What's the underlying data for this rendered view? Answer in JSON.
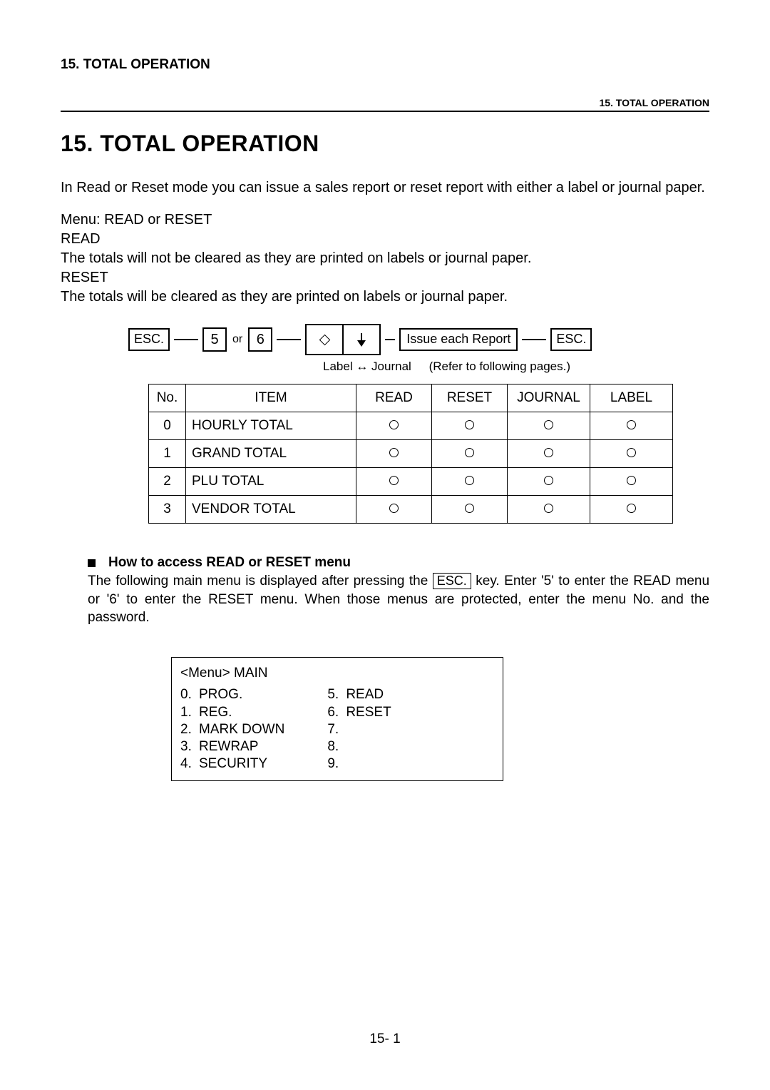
{
  "header_top": "15.  TOTAL OPERATION",
  "header_right": "15. TOTAL OPERATION",
  "title": "15.  TOTAL OPERATION",
  "intro": "In Read or Reset mode you can issue a sales report or reset report with either a label or journal paper.",
  "menu_line": "Menu:  READ or RESET",
  "read_head": "READ",
  "read_body": "The totals will not be cleared as they are printed on labels or journal paper.",
  "reset_head": "RESET",
  "reset_body": "The totals will be cleared as they are printed on labels or journal paper.",
  "diagram": {
    "esc": "ESC.",
    "k5": "5",
    "or": "or",
    "k6": "6",
    "issue": "Issue each Report",
    "label_journal": "Label ↔ Journal",
    "refer": "(Refer to following pages.)"
  },
  "table": {
    "headers": [
      "No.",
      "ITEM",
      "READ",
      "RESET",
      "JOURNAL",
      "LABEL"
    ],
    "rows": [
      {
        "no": "0",
        "item": "HOURLY TOTAL"
      },
      {
        "no": "1",
        "item": "GRAND TOTAL"
      },
      {
        "no": "2",
        "item": "PLU TOTAL"
      },
      {
        "no": "3",
        "item": "VENDOR TOTAL"
      }
    ]
  },
  "howto": {
    "title": "How to access READ or RESET menu",
    "pre": "The following main menu is displayed after pressing the",
    "esc": "ESC.",
    "post": " key.    Enter '5' to enter the READ menu or '6' to enter the RESET menu.    When those menus are protected, enter the menu No. and the password."
  },
  "menu_box": {
    "head": "<Menu>   MAIN",
    "left": [
      {
        "n": "0.",
        "t": "PROG."
      },
      {
        "n": "1.",
        "t": "REG."
      },
      {
        "n": "2.",
        "t": "MARK DOWN"
      },
      {
        "n": "3.",
        "t": "REWRAP"
      },
      {
        "n": "4.",
        "t": "SECURITY"
      }
    ],
    "right": [
      {
        "n": "5.",
        "t": "READ"
      },
      {
        "n": "6.",
        "t": "RESET"
      },
      {
        "n": "7.",
        "t": ""
      },
      {
        "n": "8.",
        "t": ""
      },
      {
        "n": "9.",
        "t": ""
      }
    ]
  },
  "footer": "15- 1"
}
